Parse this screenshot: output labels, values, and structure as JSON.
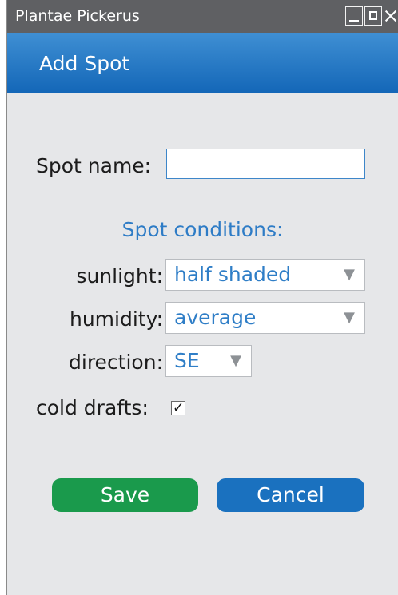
{
  "window": {
    "title": "Plantae Pickerus",
    "controls": [
      "minimize-icon",
      "maximize-icon",
      "close-icon"
    ]
  },
  "header": {
    "title": "Add Spot"
  },
  "form": {
    "spot_name_label": "Spot name:",
    "spot_name_value": "",
    "conditions_title": "Spot conditions:",
    "sunlight": {
      "label": "sunlight:",
      "value": "half shaded"
    },
    "humidity": {
      "label": "humidity:",
      "value": "average"
    },
    "direction": {
      "label": "direction:",
      "value": "SE"
    },
    "cold_drafts": {
      "label": "cold drafts:",
      "checked": true
    },
    "dropdown_icon": "triangle-down-icon"
  },
  "buttons": {
    "save": "Save",
    "cancel": "Cancel"
  },
  "colors": {
    "titlebar": "#5f6063",
    "header": "#1467b8",
    "accent_text": "#2e7cc6",
    "save": "#1a9a4c",
    "cancel": "#1a71bf",
    "background": "#e6e7e9"
  }
}
